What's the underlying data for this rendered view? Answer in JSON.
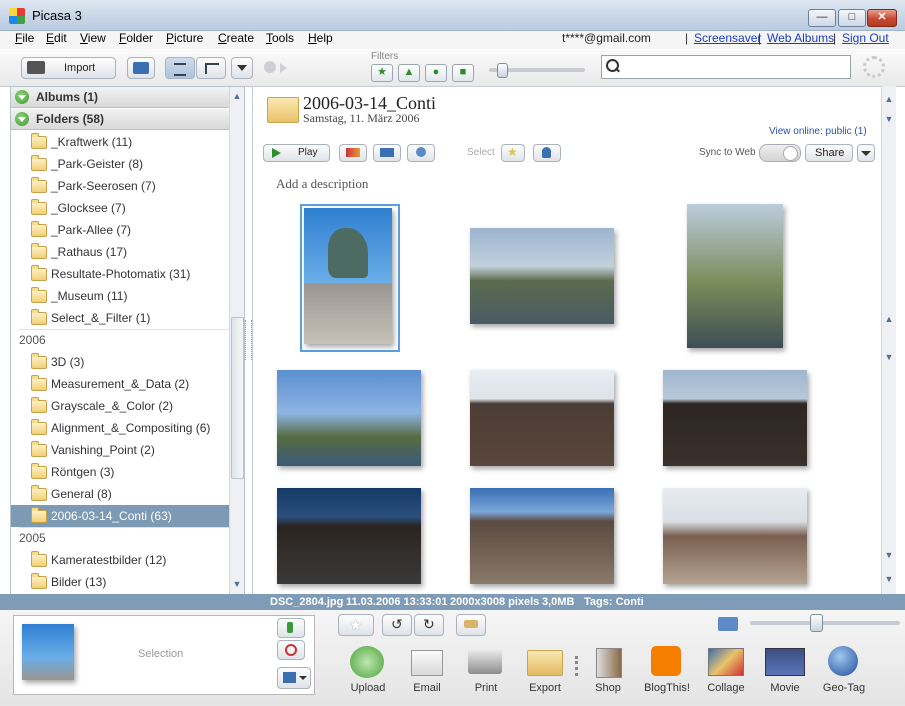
{
  "window": {
    "title": "Picasa 3",
    "minimize": "—",
    "maximize": "□",
    "close": "✕"
  },
  "menu": [
    "File",
    "Edit",
    "View",
    "Folder",
    "Picture",
    "Create",
    "Tools",
    "Help"
  ],
  "account": {
    "email": "t****@gmail.com",
    "links": [
      "Screensaver",
      "Web Albums",
      "Sign Out"
    ],
    "separator": "|"
  },
  "toolbar": {
    "import_label": "Import",
    "filters_label": "Filters",
    "search_value": ""
  },
  "sidebar": {
    "albums_header": "Albums (1)",
    "folders_header": "Folders (58)",
    "items_top": [
      "_Kraftwerk (11)",
      "_Park-Geister (8)",
      "_Park-Seerosen (7)",
      "_Glocksee (7)",
      "_Park-Allee (7)",
      "_Rathaus (17)",
      "Resultate-Photomatix (31)",
      "_Museum (11)",
      "Select_&_Filter (1)"
    ],
    "year_2006": "2006",
    "items_2006": [
      "3D (3)",
      "Measurement_&_Data (2)",
      "Grayscale_&_Color (2)",
      "Alignment_&_Compositing (6)",
      "Vanishing_Point (2)",
      "Röntgen (3)",
      "General (8)",
      "2006-03-14_Conti (63)"
    ],
    "year_2005": "2005",
    "items_2005": [
      "Kameratestbilder (12)",
      "Bilder (13)"
    ]
  },
  "album": {
    "title": "2006-03-14_Conti",
    "date": "Samstag, 11. März 2006",
    "view_online": "View online: public (1)",
    "play_label": "Play",
    "select_label": "Select",
    "sync_label": "Sync to Web",
    "share_label": "Share",
    "description_placeholder": "Add a description"
  },
  "status": {
    "file": "DSC_2804.jpg",
    "date": "11.03.2006 13:33:01",
    "size_px": "2000x3008 pixels",
    "size_mb": "3,0MB",
    "tags": "Tags: Conti"
  },
  "tray": {
    "selection_label": "Selection",
    "actions": [
      "Upload",
      "Email",
      "Print",
      "Export",
      "Shop",
      "BlogThis!",
      "Collage",
      "Movie",
      "Geo-Tag"
    ]
  },
  "zoom_level": 0.12,
  "thumb_zoom_level": 0.43,
  "colors": {
    "accent": "#7e9bb7",
    "link": "#1a3fbf",
    "selected": "#7d9ab5"
  }
}
